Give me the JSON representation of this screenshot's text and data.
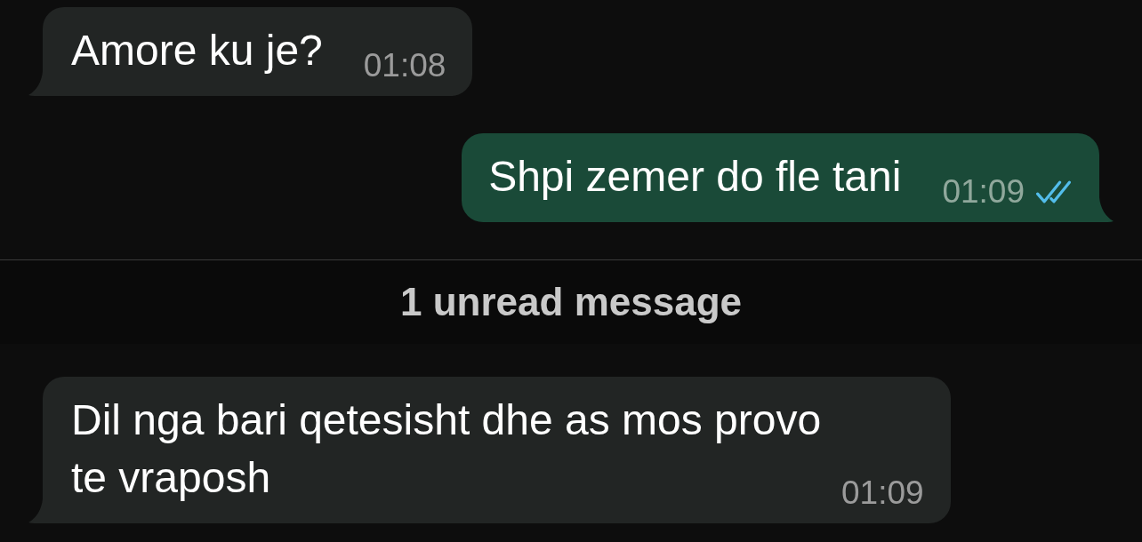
{
  "messages": [
    {
      "kind": "incoming",
      "text": "Amore ku je?",
      "time": "01:08"
    },
    {
      "kind": "outgoing",
      "text": "Shpi zemer do fle tani",
      "time": "01:09",
      "read": true
    },
    {
      "kind": "unread_divider",
      "text": "1 unread message"
    },
    {
      "kind": "incoming",
      "text": "Dil nga bari qetesisht dhe as mos provo te vraposh",
      "time": "01:09"
    }
  ]
}
